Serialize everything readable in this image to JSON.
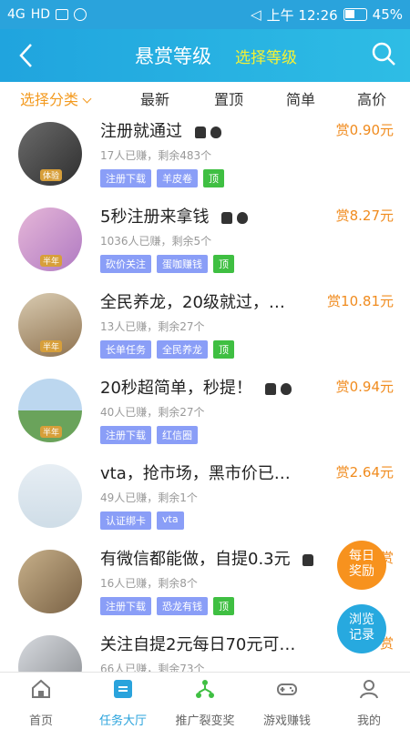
{
  "status": {
    "signal": "4G",
    "hd": "HD",
    "time": "上午 12:26",
    "battery": "45%"
  },
  "header": {
    "title": "悬赏等级",
    "choose": "选择等级"
  },
  "filters": {
    "category": "选择分类",
    "newest": "最新",
    "top": "置顶",
    "simple": "简单",
    "high": "高价"
  },
  "items": [
    {
      "title": "注册就通过",
      "meta": "17人已赚，剩余483个",
      "reward": "赏0.90元",
      "badge": "体验",
      "tags": [
        "注册下载",
        "羊皮卷",
        "顶"
      ]
    },
    {
      "title": "5秒注册来拿钱",
      "meta": "1036人已赚，剩余5个",
      "reward": "赏8.27元",
      "badge": "半年",
      "tags": [
        "砍价关注",
        "蛋咖赚钱",
        "顶"
      ]
    },
    {
      "title": "全民养龙，20级就过，…",
      "meta": "13人已赚，剩余27个",
      "reward": "赏10.81元",
      "badge": "半年",
      "tags": [
        "长单任务",
        "全民养龙",
        "顶"
      ]
    },
    {
      "title": "20秒超简单，秒提！",
      "meta": "40人已赚，剩余27个",
      "reward": "赏0.94元",
      "badge": "半年",
      "tags": [
        "注册下载",
        "红信圈"
      ]
    },
    {
      "title": "vta，抢市场，黑市价已…",
      "meta": "49人已赚，剩余1个",
      "reward": "赏2.64元",
      "badge": "",
      "tags": [
        "认证绑卡",
        "vta"
      ]
    },
    {
      "title": "有微信都能做，自提0.3元",
      "meta": "16人已赚，剩余8个",
      "reward": "赏",
      "badge": "",
      "tags": [
        "注册下载",
        "恐龙有钱",
        "顶"
      ]
    },
    {
      "title": "关注自提2元每日70元可…",
      "meta": "66人已赚，剩余73个",
      "reward": "赏",
      "badge": "",
      "tags": []
    }
  ],
  "floating": {
    "reward_line1": "每日",
    "reward_line2": "奖励",
    "history_line1": "浏览",
    "history_line2": "记录"
  },
  "tabs": {
    "home": "首页",
    "task_hall": "任务大厅",
    "promote": "推广裂变奖",
    "game": "游戏赚钱",
    "mine": "我的"
  }
}
